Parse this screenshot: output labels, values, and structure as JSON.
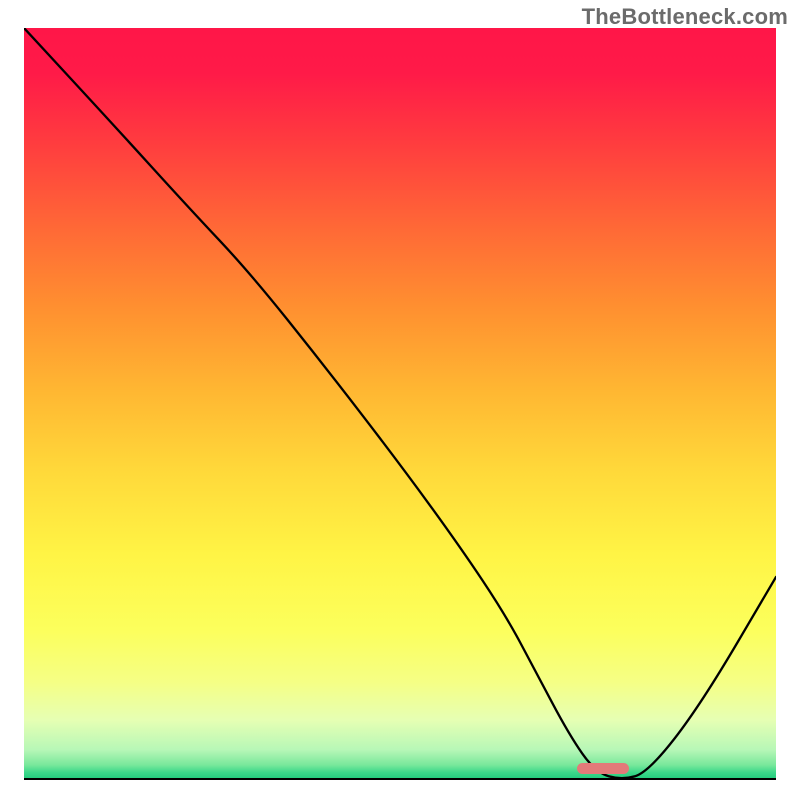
{
  "watermark": "TheBottleneck.com",
  "chart_data": {
    "type": "line",
    "title": "",
    "xlabel": "",
    "ylabel": "",
    "xlim": [
      0,
      100
    ],
    "ylim": [
      0,
      100
    ],
    "grid": false,
    "legend": false,
    "annotations": [],
    "background_gradient": {
      "direction": "top-to-bottom",
      "stops": [
        {
          "pct": 0,
          "color": "#ff1648",
          "meaning": "max-bottleneck"
        },
        {
          "pct": 50,
          "color": "#ffc138",
          "meaning": "moderate"
        },
        {
          "pct": 80,
          "color": "#fcff5c",
          "meaning": "low"
        },
        {
          "pct": 100,
          "color": "#1ec97a",
          "meaning": "min-bottleneck"
        }
      ]
    },
    "x": [
      0,
      12,
      22,
      30,
      40,
      50,
      58,
      64,
      68,
      72.5,
      76,
      79.5,
      83,
      90,
      100
    ],
    "values": [
      100,
      87,
      76,
      67.5,
      55,
      42,
      31,
      22,
      14.5,
      6,
      1,
      0,
      1,
      10,
      27
    ],
    "optimal_range_x": [
      73.5,
      80.5
    ],
    "note": "y = bottleneck severity (0 = green/none, 100 = red/max). Curve depicts valley-shaped bottleneck profile; minimum near x≈77."
  },
  "marker": {
    "color": "#e37a79",
    "x_start_pct": 73.5,
    "x_end_pct": 80.5,
    "y_pct": 0.8
  }
}
